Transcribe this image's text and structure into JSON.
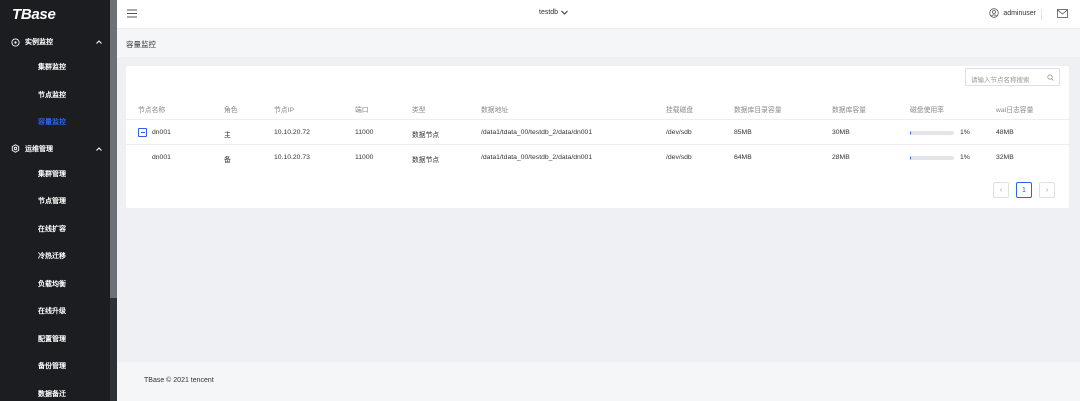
{
  "sidebar": {
    "logo": "TBase",
    "groups": [
      {
        "label": "实例监控",
        "items": [
          "集群监控",
          "节点监控",
          "容量监控"
        ],
        "active_item": "容量监控"
      },
      {
        "label": "运维管理",
        "items": [
          "集群管理",
          "节点管理",
          "在线扩容",
          "冷热迁移",
          "负载均衡",
          "在线升级",
          "配置管理",
          "备份管理",
          "数据备迁"
        ]
      }
    ]
  },
  "header": {
    "database": "testdb",
    "user": "adminuser",
    "icons": [
      "menu-icon",
      "chevron-down-icon",
      "user-icon",
      "mail-icon"
    ]
  },
  "page": {
    "title": "容量监控"
  },
  "search": {
    "placeholder": "请输入节点名称搜索"
  },
  "table": {
    "columns": [
      "节点名称",
      "角色",
      "节点IP",
      "端口",
      "类型",
      "数据地址",
      "挂载磁盘",
      "数据库目录容量",
      "数据库容量",
      "磁盘使用率",
      "wal日志容量"
    ],
    "rows": [
      {
        "name": "dn001",
        "role": "主",
        "ip": "10.10.20.72",
        "port": "11000",
        "type": "数据节点",
        "data_path": "/data1/tdata_00/testdb_2/data/dn001",
        "disk": "/dev/sdb",
        "dir_size": "85MB",
        "db_size": "30MB",
        "usage": 1,
        "usage_label": "1%",
        "wal_size": "48MB",
        "expandable": true
      },
      {
        "name": "dn001",
        "role": "备",
        "ip": "10.10.20.73",
        "port": "11000",
        "type": "数据节点",
        "data_path": "/data1/tdata_00/testdb_2/data/dn001",
        "disk": "/dev/sdb",
        "dir_size": "64MB",
        "db_size": "28MB",
        "usage": 1,
        "usage_label": "1%",
        "wal_size": "32MB",
        "expandable": false
      }
    ]
  },
  "pagination": {
    "current": "1",
    "prev": "‹",
    "next": "›"
  },
  "footer": {
    "text": "TBase © 2021 tencent"
  },
  "colors": {
    "accent": "#2b62e6",
    "sidebar_bg": "#1b1d21",
    "page_bg": "#eef0f3"
  }
}
